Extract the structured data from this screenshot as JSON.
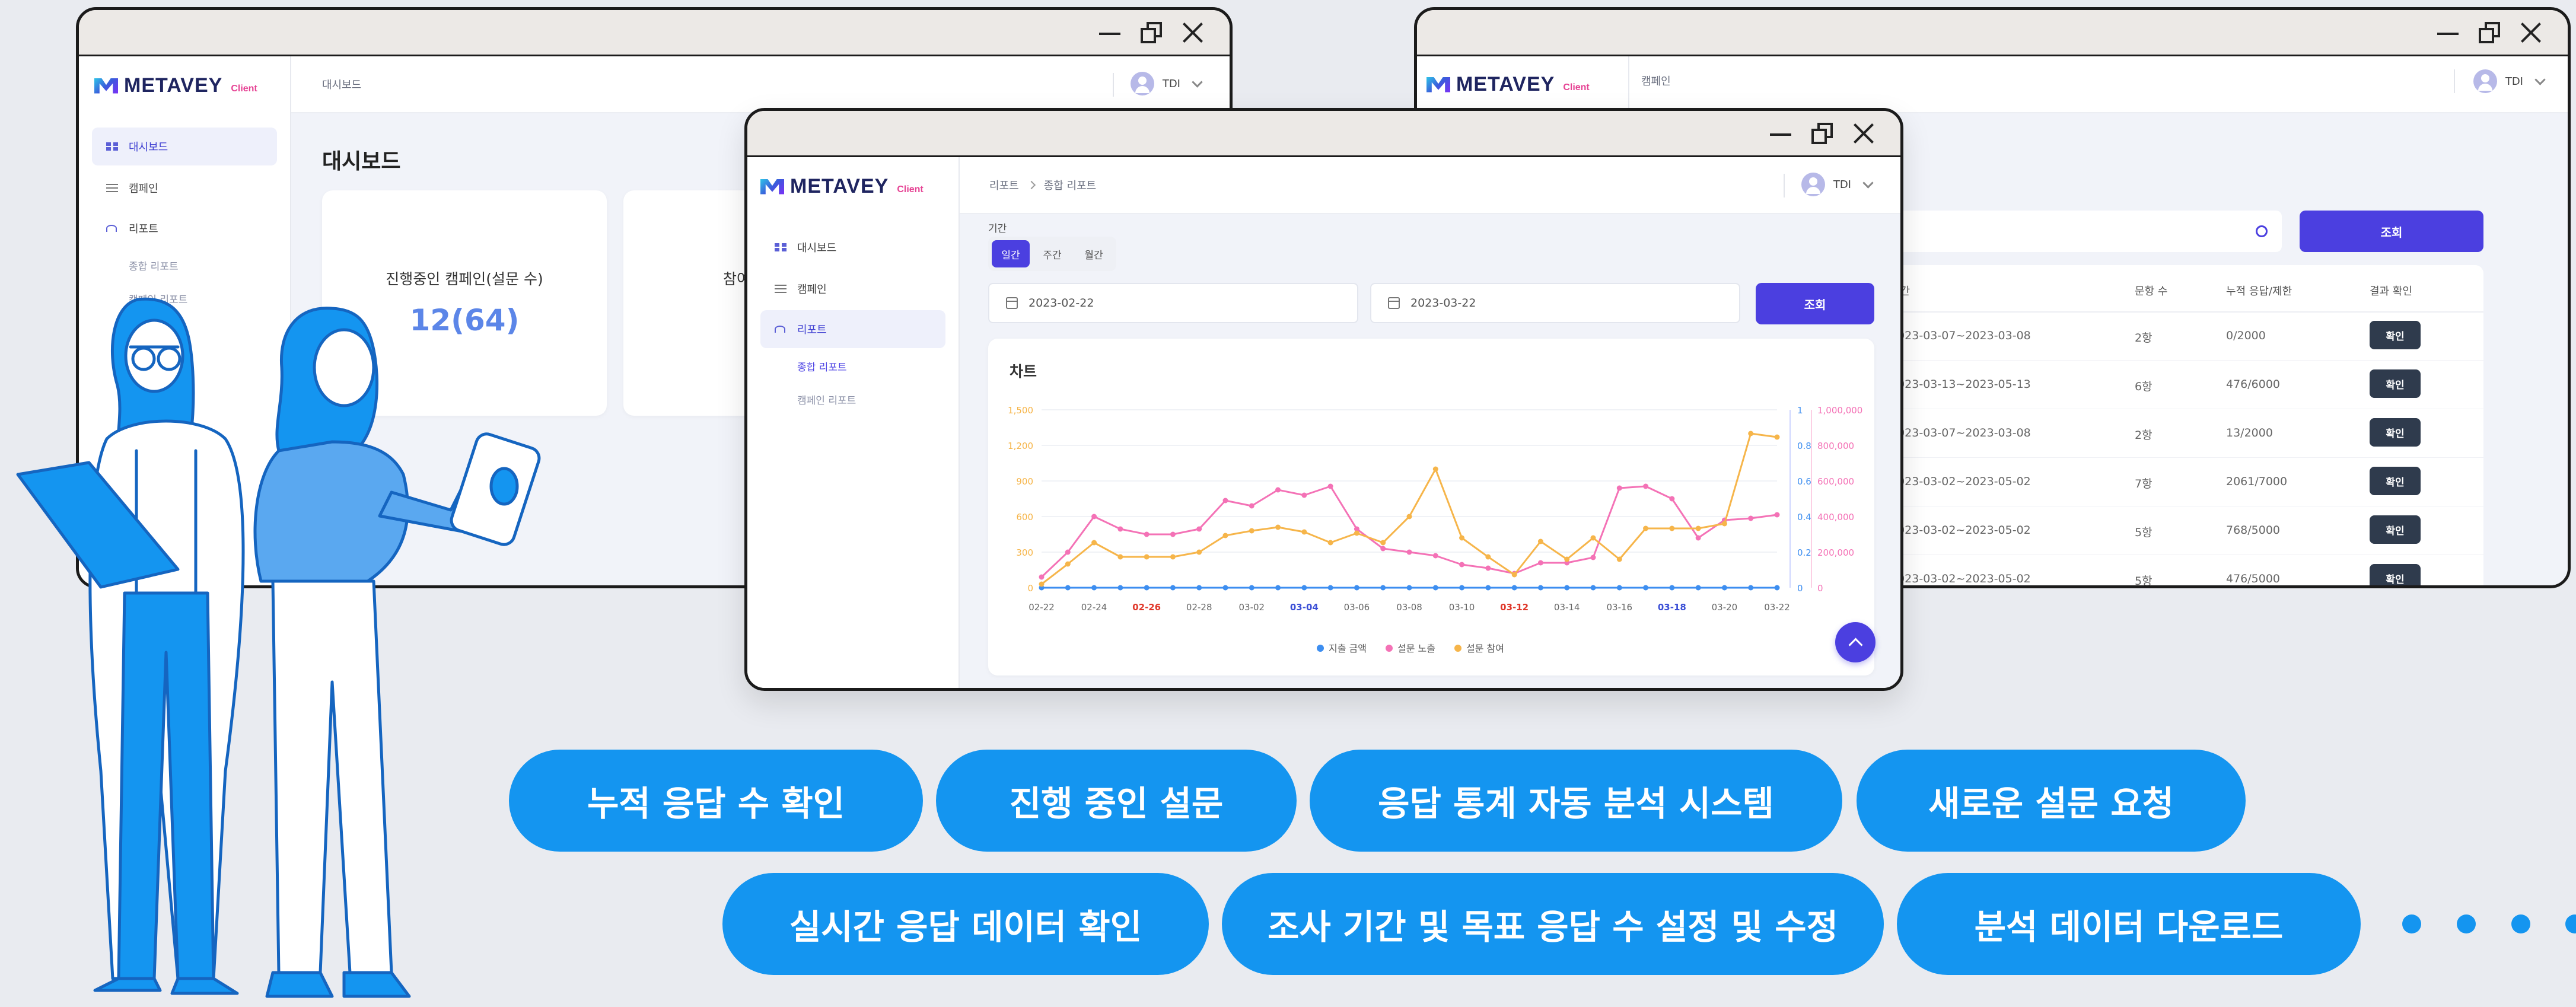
{
  "brand": {
    "name": "METAVEY",
    "suffix": "Client"
  },
  "user": {
    "name": "TDI"
  },
  "nav": {
    "dashboard": "대시보드",
    "campaign": "캠페인",
    "report": "리포트",
    "sub_total": "종합 리포트",
    "sub_campaign": "캠페인 리포트"
  },
  "win_dashboard": {
    "crumb": "대시보드",
    "page_title": "대시보드",
    "card1_label": "진행중인 캠페인(설문 수)",
    "card1_value": "12(64)",
    "card2_label": "참여"
  },
  "win_campaign": {
    "crumb": "캠페인",
    "search_button": "조회",
    "columns": [
      "기간",
      "문항 수",
      "누적 응답/제한",
      "결과 확인"
    ],
    "rows": [
      {
        "period": "2023-03-07~2023-03-08",
        "questions": "2항",
        "responses": "0/2000",
        "action": "확인"
      },
      {
        "period": "2023-03-13~2023-05-13",
        "questions": "6항",
        "responses": "476/6000",
        "action": "확인"
      },
      {
        "period": "2023-03-07~2023-03-08",
        "questions": "2항",
        "responses": "13/2000",
        "action": "확인"
      },
      {
        "period": "2023-03-02~2023-05-02",
        "questions": "7항",
        "responses": "2061/7000",
        "action": "확인"
      },
      {
        "period": "2023-03-02~2023-05-02",
        "questions": "5항",
        "responses": "768/5000",
        "action": "확인"
      },
      {
        "period": "2023-03-02~2023-05-02",
        "questions": "5항",
        "responses": "476/5000",
        "action": "확인"
      }
    ]
  },
  "win_report": {
    "crumb_parent": "리포트",
    "crumb_current": "종합 리포트",
    "period_label": "기간",
    "segments": [
      "일간",
      "주간",
      "월간"
    ],
    "selected_segment": "일간",
    "start_date": "2023-02-22",
    "end_date": "2023-03-22",
    "search_button": "조회",
    "chart_title": "차트"
  },
  "colors": {
    "accent": "#4b3fe0",
    "pill": "#1495f0",
    "series_spend": "#3d8ef0",
    "series_exposure": "#f472b6",
    "series_participation": "#f6b54a"
  },
  "chart_data": {
    "type": "line",
    "title": "차트",
    "x": [
      "02-22",
      "02-23",
      "02-24",
      "02-25",
      "02-26",
      "02-27",
      "02-28",
      "03-01",
      "03-02",
      "03-03",
      "03-04",
      "03-05",
      "03-06",
      "03-07",
      "03-08",
      "03-09",
      "03-10",
      "03-11",
      "03-12",
      "03-13",
      "03-14",
      "03-15",
      "03-16",
      "03-17",
      "03-18",
      "03-19",
      "03-20",
      "03-21",
      "03-22"
    ],
    "x_tick_labels": [
      "02-22",
      "02-24",
      "02-26",
      "02-28",
      "03-02",
      "03-04",
      "03-06",
      "03-08",
      "03-10",
      "03-12",
      "03-14",
      "03-16",
      "03-18",
      "03-20",
      "03-22"
    ],
    "x_tick_colors": [
      "#666",
      "#666",
      "#e0382b",
      "#666",
      "#666",
      "#3b4fd6",
      "#666",
      "#666",
      "#666",
      "#e0382b",
      "#666",
      "#666",
      "#3b4fd6",
      "#666",
      "#666"
    ],
    "axes": {
      "left": {
        "ticks": [
          "0",
          "300",
          "600",
          "900",
          "1,200",
          "1,500"
        ],
        "ylim": [
          0,
          1500
        ],
        "color": "#f6b54a"
      },
      "mid": {
        "ticks": [
          "0",
          "0.2",
          "0.4",
          "0.6",
          "0.8",
          "1"
        ],
        "ylim": [
          0,
          1
        ],
        "color": "#3d8ef0"
      },
      "right": {
        "ticks": [
          "0",
          "200,000",
          "400,000",
          "600,000",
          "800,000",
          "1,000,000"
        ],
        "ylim": [
          0,
          1000000
        ],
        "color": "#f472b6"
      }
    },
    "series": [
      {
        "name": "지출 금액",
        "axis": "mid",
        "color": "#3d8ef0",
        "values": [
          0,
          0,
          0,
          0,
          0,
          0,
          0,
          0,
          0,
          0,
          0,
          0,
          0,
          0,
          0,
          0,
          0,
          0,
          0,
          0,
          0,
          0,
          0,
          0,
          0,
          0,
          0,
          0,
          0
        ]
      },
      {
        "name": "설문 노출",
        "axis": "right",
        "color": "#f472b6",
        "values": [
          60000,
          200000,
          400000,
          330000,
          300000,
          300000,
          330000,
          490000,
          460000,
          550000,
          520000,
          570000,
          330000,
          220000,
          200000,
          180000,
          130000,
          110000,
          80000,
          140000,
          140000,
          170000,
          560000,
          570000,
          500000,
          280000,
          380000,
          390000,
          410000
        ]
      },
      {
        "name": "설문 참여",
        "axis": "left",
        "color": "#f6b54a",
        "values": [
          30,
          200,
          380,
          260,
          260,
          260,
          300,
          440,
          480,
          510,
          470,
          380,
          460,
          380,
          600,
          1000,
          420,
          260,
          110,
          390,
          240,
          420,
          240,
          500,
          500,
          500,
          540,
          1300,
          1270
        ]
      }
    ],
    "legend_position": "bottom",
    "grid": true
  },
  "feature_pills": {
    "row1": [
      "누적 응답 수 확인",
      "진행 중인 설문",
      "응답 통계 자동 분석 시스템",
      "새로운 설문 요청"
    ],
    "row2": [
      "실시간 응답 데이터 확인",
      "조사 기간 및 목표 응답 수 설정 및 수정",
      "분석 데이터 다운로드"
    ]
  }
}
